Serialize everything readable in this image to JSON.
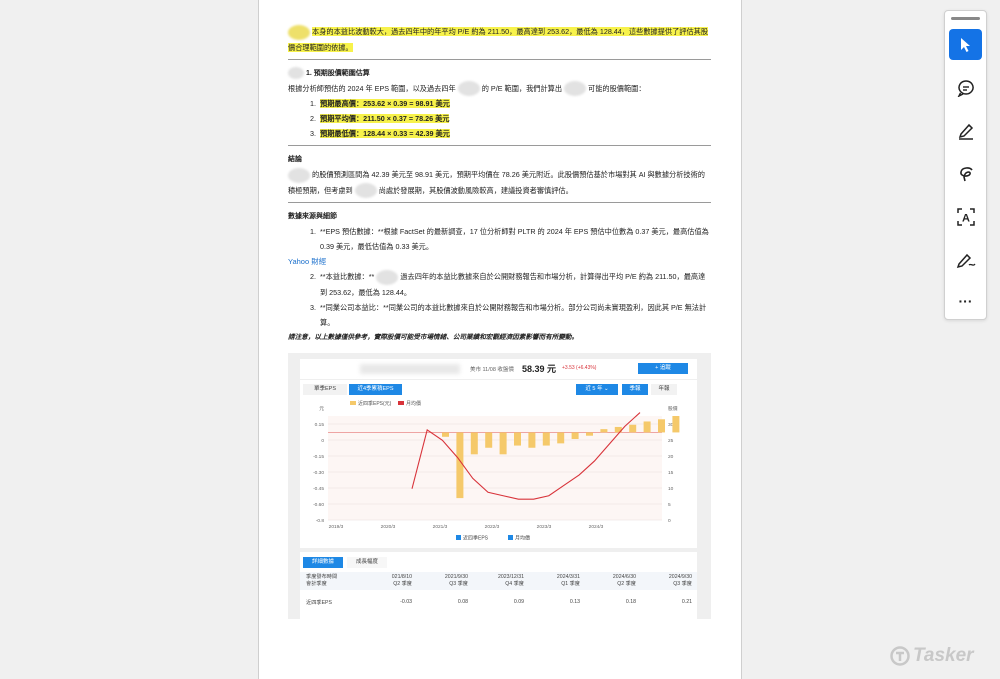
{
  "doc": {
    "p1": "本身的本益比波動較大，過去四年中的年平均 P/E 約為 211.50，最高達到 253.62，最低為 128.44，這些數據提供了評估其股價合理範圍的依據。",
    "s1_title": "1. 預期股價範圍估算",
    "s1_intro_a": "根據分析師預估的 2024 年 EPS 範圍，以及過去四年",
    "s1_intro_b": "的 P/E 範圍，我們計算出",
    "s1_intro_c": "可能的股價範圍：",
    "s1_items": [
      "預期最高價：253.62 × 0.39 = 98.91 美元",
      "預期平均價：211.50 × 0.37 = 78.26 美元",
      "預期最低價：128.44 × 0.33 = 42.39 美元"
    ],
    "s2_title": "結論",
    "s2_body_a": "的股價預測區間為 42.39 美元至 98.91 美元，預期平均價在 78.26 美元附近。此股價預估基於市場對其 AI 與數據分析技術的積極預期，但考慮到",
    "s2_body_b": "尚處於發展期，其股價波動風險較高，建議投資者審慎評估。",
    "s3_title": "數據來源與細節",
    "s3_item1": "**EPS 預估數據：**根據 FactSet 的最新調查，17 位分析師對 PLTR 的 2024 年 EPS 預估中位數為 0.37 美元，最高估值為 0.39 美元，最低估值為 0.33 美元。",
    "s3_link": "Yahoo 財經",
    "s3_item2_a": "**本益比數據：**",
    "s3_item2_b": "過去四年的本益比數據來自於公開財務報告和市場分析，計算得出平均 P/E 約為 211.50，最高達到 253.62，最低為 128.44。",
    "s3_item3": "**同業公司本益比：**同業公司的本益比數據來自於公開財務報告和市場分析。部分公司尚未實現盈利，因此其 P/E 無法計算。",
    "note": "請注意，以上數據僅供參考，實際股價可能受市場情緒、公司業績和宏觀經濟因素影響而有所變動。"
  },
  "embedded": {
    "price_label": "美市 11/08 收盤價",
    "price": "58.39 元",
    "change": "+3.53 (+6.43%)",
    "follow_btn": "+ 追蹤",
    "tab_single": "單季EPS",
    "tab_ttm": "近4季累積EPS",
    "range_btn": "近 5 年",
    "period_btns": [
      "季報",
      "年報"
    ],
    "legend": [
      "近四季EPS(元)",
      "月均價"
    ],
    "y_left_ticks": [
      "元",
      "0.15",
      "0",
      "-0.15",
      "-0.30",
      "-0.45",
      "-0.60",
      "-0.8"
    ],
    "y_right_ticks": [
      "股價",
      "30",
      "25",
      "20",
      "15",
      "10",
      "5",
      "0"
    ],
    "x_ticks": [
      "2019/3",
      "2020/3",
      "2021/3",
      "2022/3",
      "2023/3",
      "2024/3"
    ],
    "checkboxes": [
      "近四季EPS",
      "月均價"
    ],
    "table_tabs": [
      "詳細數據",
      "成長幅度"
    ],
    "table_head_label": [
      "季度發布時間",
      "會計季度"
    ],
    "table_cols": [
      [
        "021/8/10",
        "Q2 季度"
      ],
      [
        "2021/9/30",
        "Q3 季度"
      ],
      [
        "2023/12/31",
        "Q4 季度"
      ],
      [
        "2024/3/31",
        "Q1 季度"
      ],
      [
        "2024/6/30",
        "Q2 季度"
      ],
      [
        "2024/9/30",
        "Q3 季度"
      ]
    ],
    "table_row_label": "近四季EPS",
    "table_row_values": [
      "-0.03",
      "0.08",
      "0.09",
      "0.13",
      "0.18",
      "0.21"
    ],
    "colors": {
      "bar": "#f5c96a",
      "line": "#d8333a",
      "blue": "#1e88e5"
    }
  },
  "chart_data": {
    "type": "bar",
    "title": "",
    "series": [
      {
        "name": "近四季EPS(元)",
        "values": [
          -0.04,
          -0.6,
          -0.2,
          -0.14,
          -0.2,
          -0.12,
          -0.14,
          -0.12,
          -0.1,
          -0.06,
          -0.03,
          0.03,
          0.05,
          0.07,
          0.1,
          0.12,
          0.15
        ]
      },
      {
        "name": "月均價",
        "values": [
          9,
          26,
          23,
          18,
          12,
          8,
          7,
          6,
          6,
          7,
          10,
          13,
          17,
          22,
          27,
          31
        ]
      }
    ],
    "ylim": [
      -0.8,
      0.15
    ],
    "y2lim": [
      0,
      30
    ]
  },
  "toolbar": {
    "tools": [
      "select-tool",
      "comment-tool",
      "highlight-tool",
      "draw-tool",
      "text-recognition-tool",
      "sign-tool",
      "more-tool"
    ],
    "more_label": "···"
  },
  "watermark": {
    "text": "Tasker"
  }
}
